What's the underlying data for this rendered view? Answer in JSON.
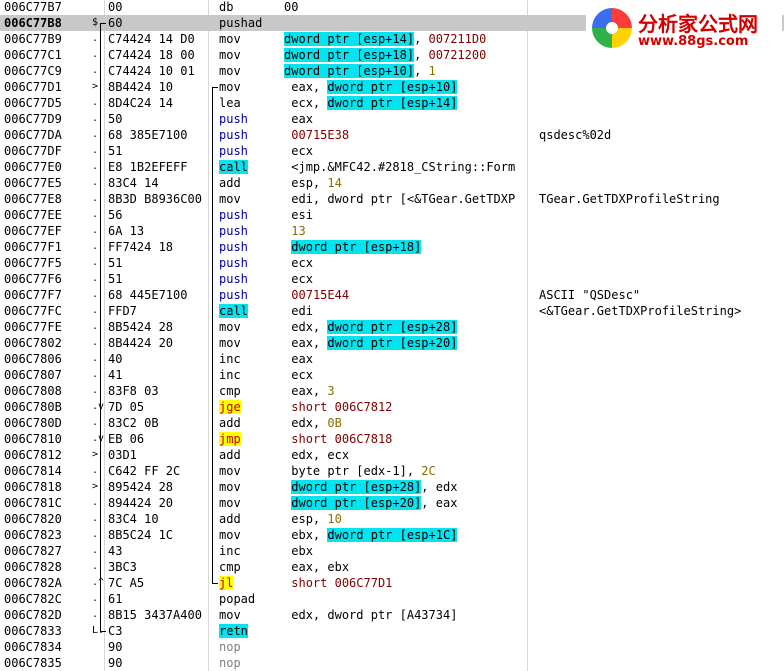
{
  "disasm": {
    "rows": [
      {
        "addr": "006C77B7",
        "mark": "",
        "hex": "00",
        "ins": [
          {
            "t": "db       00"
          }
        ],
        "cmt": ""
      },
      {
        "addr": "006C77B8",
        "mark": "$",
        "hex": "60",
        "ins": [
          {
            "t": "pushad"
          }
        ],
        "cmt": ""
      },
      {
        "addr": "006C77B9",
        "mark": ".",
        "hex": "C74424 14 D0",
        "ins": [
          {
            "t": "mov      "
          },
          {
            "t": "dword ptr [esp+14]",
            "h": "cyan"
          },
          {
            "t": ", "
          },
          {
            "t": "007211D0",
            "k": "addr"
          }
        ],
        "cmt": ""
      },
      {
        "addr": "006C77C1",
        "mark": ".",
        "hex": "C74424 18 00",
        "ins": [
          {
            "t": "mov      "
          },
          {
            "t": "dword ptr [esp+18]",
            "h": "cyan"
          },
          {
            "t": ", "
          },
          {
            "t": "00721200",
            "k": "addr"
          }
        ],
        "cmt": ""
      },
      {
        "addr": "006C77C9",
        "mark": ".",
        "hex": "C74424 10 01",
        "ins": [
          {
            "t": "mov      "
          },
          {
            "t": "dword ptr [esp+10]",
            "h": "cyan"
          },
          {
            "t": ", "
          },
          {
            "t": "1",
            "k": "num"
          }
        ],
        "cmt": ""
      },
      {
        "addr": "006C77D1",
        "mark": ">",
        "hex": "8B4424 10",
        "ins": [
          {
            "t": "mov       eax, "
          },
          {
            "t": "dword ptr [esp+10]",
            "h": "cyan"
          }
        ],
        "cmt": ""
      },
      {
        "addr": "006C77D5",
        "mark": ".",
        "hex": "8D4C24 14",
        "ins": [
          {
            "t": "lea       ecx, "
          },
          {
            "t": "dword ptr [esp+14]",
            "h": "cyan"
          }
        ],
        "cmt": ""
      },
      {
        "addr": "006C77D9",
        "mark": ".",
        "hex": "50",
        "ins": [
          {
            "t": "push",
            "k": "push"
          },
          {
            "t": "      eax"
          }
        ],
        "cmt": ""
      },
      {
        "addr": "006C77DA",
        "mark": ".",
        "hex": "68 385E7100",
        "ins": [
          {
            "t": "push",
            "k": "push"
          },
          {
            "t": "      "
          },
          {
            "t": "00715E38",
            "k": "addr"
          }
        ],
        "cmt": "qsdesc%02d"
      },
      {
        "addr": "006C77DF",
        "mark": ".",
        "hex": "51",
        "ins": [
          {
            "t": "push",
            "k": "push"
          },
          {
            "t": "      ecx"
          }
        ],
        "cmt": ""
      },
      {
        "addr": "006C77E0",
        "mark": ".",
        "hex": "E8 1B2EFEFF",
        "ins": [
          {
            "t": "call",
            "h": "call"
          },
          {
            "t": "      <jmp.&MFC42.#2818_CString::Form"
          }
        ],
        "cmt": ""
      },
      {
        "addr": "006C77E5",
        "mark": ".",
        "hex": "83C4 14",
        "ins": [
          {
            "t": "add       esp, "
          },
          {
            "t": "14",
            "k": "num"
          }
        ],
        "cmt": ""
      },
      {
        "addr": "006C77E8",
        "mark": ".",
        "hex": "8B3D B8936C00",
        "ins": [
          {
            "t": "mov       edi, dword ptr [<&TGear.GetTDXP"
          }
        ],
        "cmt": "TGear.GetTDXProfileString"
      },
      {
        "addr": "006C77EE",
        "mark": ".",
        "hex": "56",
        "ins": [
          {
            "t": "push",
            "k": "push"
          },
          {
            "t": "      esi"
          }
        ],
        "cmt": ""
      },
      {
        "addr": "006C77EF",
        "mark": ".",
        "hex": "6A 13",
        "ins": [
          {
            "t": "push",
            "k": "push"
          },
          {
            "t": "      "
          },
          {
            "t": "13",
            "k": "num"
          }
        ],
        "cmt": ""
      },
      {
        "addr": "006C77F1",
        "mark": ".",
        "hex": "FF7424 18",
        "ins": [
          {
            "t": "push",
            "k": "push"
          },
          {
            "t": "      "
          },
          {
            "t": "dword ptr [esp+18]",
            "h": "cyan"
          }
        ],
        "cmt": ""
      },
      {
        "addr": "006C77F5",
        "mark": ".",
        "hex": "51",
        "ins": [
          {
            "t": "push",
            "k": "push"
          },
          {
            "t": "      ecx"
          }
        ],
        "cmt": ""
      },
      {
        "addr": "006C77F6",
        "mark": ".",
        "hex": "51",
        "ins": [
          {
            "t": "push",
            "k": "push"
          },
          {
            "t": "      ecx"
          }
        ],
        "cmt": ""
      },
      {
        "addr": "006C77F7",
        "mark": ".",
        "hex": "68 445E7100",
        "ins": [
          {
            "t": "push",
            "k": "push"
          },
          {
            "t": "      "
          },
          {
            "t": "00715E44",
            "k": "addr"
          }
        ],
        "cmt": "ASCII \"QSDesc\""
      },
      {
        "addr": "006C77FC",
        "mark": ".",
        "hex": "FFD7",
        "ins": [
          {
            "t": "call",
            "h": "call"
          },
          {
            "t": "      edi"
          }
        ],
        "cmt": "<&TGear.GetTDXProfileString>"
      },
      {
        "addr": "006C77FE",
        "mark": ".",
        "hex": "8B5424 28",
        "ins": [
          {
            "t": "mov       edx, "
          },
          {
            "t": "dword ptr [esp+28]",
            "h": "cyan"
          }
        ],
        "cmt": ""
      },
      {
        "addr": "006C7802",
        "mark": ".",
        "hex": "8B4424 20",
        "ins": [
          {
            "t": "mov       eax, "
          },
          {
            "t": "dword ptr [esp+20]",
            "h": "cyan"
          }
        ],
        "cmt": ""
      },
      {
        "addr": "006C7806",
        "mark": ".",
        "hex": "40",
        "ins": [
          {
            "t": "inc       eax"
          }
        ],
        "cmt": ""
      },
      {
        "addr": "006C7807",
        "mark": ".",
        "hex": "41",
        "ins": [
          {
            "t": "inc       ecx"
          }
        ],
        "cmt": ""
      },
      {
        "addr": "006C7808",
        "mark": ".",
        "hex": "83F8 03",
        "ins": [
          {
            "t": "cmp       eax, "
          },
          {
            "t": "3",
            "k": "num"
          }
        ],
        "cmt": ""
      },
      {
        "addr": "006C780B",
        "mark": ".v",
        "hex": "7D 05",
        "ins": [
          {
            "t": "jge",
            "h": "yel"
          },
          {
            "t": "       "
          },
          {
            "t": "short 006C7812",
            "k": "addr"
          }
        ],
        "cmt": ""
      },
      {
        "addr": "006C780D",
        "mark": ".",
        "hex": "83C2 0B",
        "ins": [
          {
            "t": "add       edx, "
          },
          {
            "t": "0B",
            "k": "num"
          }
        ],
        "cmt": ""
      },
      {
        "addr": "006C7810",
        "mark": ".v",
        "hex": "EB 06",
        "ins": [
          {
            "t": "jmp",
            "h": "yel"
          },
          {
            "t": "       "
          },
          {
            "t": "short 006C7818",
            "k": "addr"
          }
        ],
        "cmt": ""
      },
      {
        "addr": "006C7812",
        "mark": ">",
        "hex": "03D1",
        "ins": [
          {
            "t": "add       edx, ecx"
          }
        ],
        "cmt": ""
      },
      {
        "addr": "006C7814",
        "mark": ".",
        "hex": "C642 FF 2C",
        "ins": [
          {
            "t": "mov       byte ptr [edx-1], "
          },
          {
            "t": "2C",
            "k": "num"
          }
        ],
        "cmt": ""
      },
      {
        "addr": "006C7818",
        "mark": ">",
        "hex": "895424 28",
        "ins": [
          {
            "t": "mov       "
          },
          {
            "t": "dword ptr [esp+28]",
            "h": "cyan"
          },
          {
            "t": ", edx"
          }
        ],
        "cmt": ""
      },
      {
        "addr": "006C781C",
        "mark": ".",
        "hex": "894424 20",
        "ins": [
          {
            "t": "mov       "
          },
          {
            "t": "dword ptr [esp+20]",
            "h": "cyan"
          },
          {
            "t": ", eax"
          }
        ],
        "cmt": ""
      },
      {
        "addr": "006C7820",
        "mark": ".",
        "hex": "83C4 10",
        "ins": [
          {
            "t": "add       esp, "
          },
          {
            "t": "10",
            "k": "num"
          }
        ],
        "cmt": ""
      },
      {
        "addr": "006C7823",
        "mark": ".",
        "hex": "8B5C24 1C",
        "ins": [
          {
            "t": "mov       ebx, "
          },
          {
            "t": "dword ptr [esp+1C]",
            "h": "cyan"
          }
        ],
        "cmt": ""
      },
      {
        "addr": "006C7827",
        "mark": ".",
        "hex": "43",
        "ins": [
          {
            "t": "inc       ebx"
          }
        ],
        "cmt": ""
      },
      {
        "addr": "006C7828",
        "mark": ".",
        "hex": "3BC3",
        "ins": [
          {
            "t": "cmp       eax, ebx"
          }
        ],
        "cmt": ""
      },
      {
        "addr": "006C782A",
        "mark": ".^",
        "hex": "7C A5",
        "ins": [
          {
            "t": "jl",
            "h": "yel"
          },
          {
            "t": "        "
          },
          {
            "t": "short 006C77D1",
            "k": "addr"
          }
        ],
        "cmt": ""
      },
      {
        "addr": "006C782C",
        "mark": ".",
        "hex": "61",
        "ins": [
          {
            "t": "popad"
          }
        ],
        "cmt": ""
      },
      {
        "addr": "006C782D",
        "mark": ".",
        "hex": "8B15 3437A400",
        "ins": [
          {
            "t": "mov       edx, dword ptr [A43734]"
          }
        ],
        "cmt": ""
      },
      {
        "addr": "006C7833",
        "mark": "L.",
        "hex": "C3",
        "ins": [
          {
            "t": "retn",
            "h": "call"
          }
        ],
        "cmt": ""
      },
      {
        "addr": "006C7834",
        "mark": "",
        "hex": "90",
        "ins": [
          {
            "t": "nop",
            "k": "nop"
          }
        ],
        "cmt": ""
      },
      {
        "addr": "006C7835",
        "mark": "",
        "hex": "90",
        "ins": [
          {
            "t": "nop",
            "k": "nop"
          }
        ],
        "cmt": ""
      }
    ]
  },
  "logo": {
    "title": "分析家公式网",
    "url": "www.88gs.com"
  },
  "colors": {
    "selected_row": "#c8c8c8",
    "operand_highlight": "#00e5f0",
    "jump_highlight": "#ffff00",
    "numeric": "#8a6d00",
    "address": "#800000",
    "logo_red": "#d40000"
  }
}
